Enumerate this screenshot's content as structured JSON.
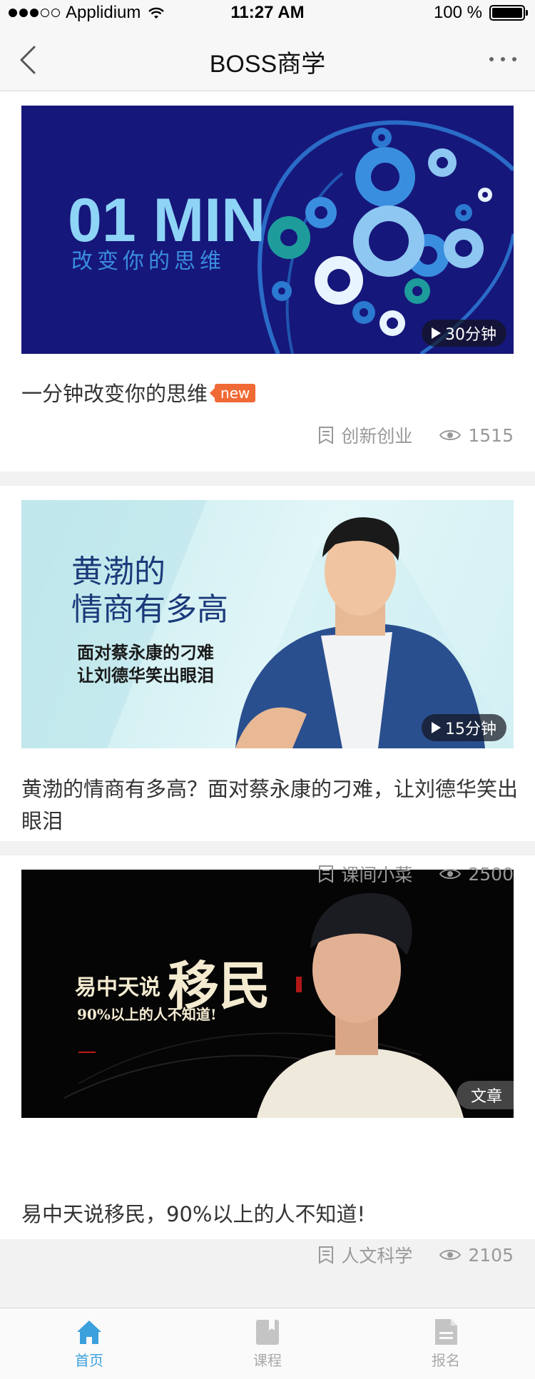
{
  "status_bar": {
    "carrier": "Applidium",
    "time": "11:27 AM",
    "battery": "100 %"
  },
  "nav": {
    "title": "BOSS商学",
    "back_icon": "chevron-left-icon",
    "more_icon": "more-dots-icon"
  },
  "colors": {
    "accent": "#3ba0dc",
    "new_tag": "#f06a35",
    "meta_text": "#999999"
  },
  "cards": [
    {
      "image_text": {
        "headline": "01 MIN",
        "subline": "改变你的思维"
      },
      "badge": "30分钟",
      "title": "一分钟改变你的思维",
      "tag": "new",
      "category": "创新创业",
      "views": "1515"
    },
    {
      "image_text": {
        "headline_1": "黄渤的",
        "headline_2": "情商有多高",
        "sub_1": "面对蔡永康的刁难",
        "sub_2": "让刘德华笑出眼泪"
      },
      "badge": "15分钟",
      "title": "黄渤的情商有多高？面对蔡永康的刁难，让刘德华笑出眼泪",
      "category": "课间小菜",
      "views": "2500"
    },
    {
      "image_text": {
        "headline_small": "易中天说",
        "headline_big": "移民",
        "sub": "90%以上的人不知道!"
      },
      "badge": "文章",
      "title": "易中天说移民，90%以上的人不知道!",
      "category": "人文科学",
      "views": "2105"
    }
  ],
  "tabs": [
    {
      "label": "首页",
      "icon": "home-icon",
      "active": true
    },
    {
      "label": "课程",
      "icon": "bookmark-book-icon",
      "active": false
    },
    {
      "label": "报名",
      "icon": "document-icon",
      "active": false
    }
  ]
}
